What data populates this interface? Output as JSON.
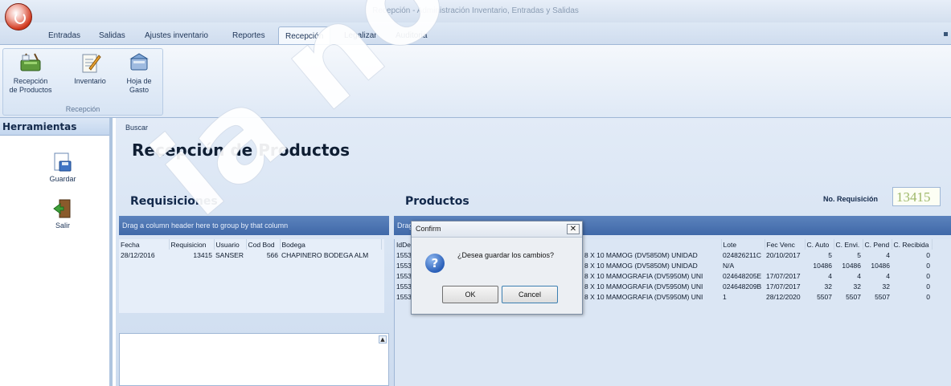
{
  "window": {
    "title": "Recepción - Administración Inventario, Entradas y Salidas"
  },
  "tabs": [
    {
      "label": "Entradas",
      "active": false
    },
    {
      "label": "Salidas",
      "active": false
    },
    {
      "label": "Ajustes inventario",
      "active": false
    },
    {
      "label": "Reportes",
      "active": false
    },
    {
      "label": "Recepción",
      "active": true
    },
    {
      "label": "Legalizar",
      "active": false
    },
    {
      "label": "Auditoria",
      "active": false
    }
  ],
  "ribbon": {
    "group_label": "Recepción",
    "buttons": [
      {
        "label_line1": "Recepción",
        "label_line2": "de Productos",
        "icon": "basket-icon"
      },
      {
        "label_line1": "Inventario",
        "label_line2": "",
        "icon": "clipboard-pencil-icon"
      },
      {
        "label_line1": "Hoja de",
        "label_line2": "Gasto",
        "icon": "basket-sheet-icon"
      }
    ]
  },
  "tools": {
    "header": "Herramientas",
    "items": [
      {
        "label": "Guardar",
        "icon": "save-icon"
      },
      {
        "label": "Salir",
        "icon": "exit-door-icon"
      }
    ]
  },
  "main": {
    "search_label": "Buscar",
    "page_title": "Recepción de Productos",
    "requisiciones": {
      "title": "Requisiciones",
      "group_hint": "Drag a column header here to group by that column",
      "columns": [
        "Fecha",
        "Requisicion",
        "Usuario",
        "Cod Bod",
        "Bodega"
      ],
      "rows": [
        [
          "28/12/2016",
          "13415",
          "SANSER",
          "566",
          "CHAPINERO BODEGA ALM"
        ]
      ]
    },
    "productos": {
      "title": "Productos",
      "req_label": "No. Requisición",
      "req_value": "13415",
      "group_hint": "Drag a column header here to group by that column",
      "columns": [
        "IdDe",
        "",
        "Lote",
        "Fec Venc",
        "C. Auto",
        "C. Envi.",
        "C. Pend",
        "C. Recibida"
      ],
      "rows": [
        [
          "1553",
          "8 X 10 MAMOG (DV5850M) UNIDAD",
          "024826211C",
          "20/10/2017",
          "5",
          "5",
          "4",
          "0"
        ],
        [
          "1553",
          "8 X 10 MAMOG (DV5850M) UNIDAD",
          "N/A",
          "",
          "10486",
          "10486",
          "10486",
          "0"
        ],
        [
          "1553",
          "8 X 10 MAMOGRAFIA (DV5950M) UNI",
          "024648205E",
          "17/07/2017",
          "4",
          "4",
          "4",
          "0"
        ],
        [
          "1553",
          "8 X 10 MAMOGRAFIA (DV5950M) UNI",
          "024648209B",
          "17/07/2017",
          "32",
          "32",
          "32",
          "0"
        ],
        [
          "1553",
          "8 X 10 MAMOGRAFIA (DV5950M) UNI",
          "1",
          "28/12/2020",
          "5507",
          "5507",
          "5507",
          "0"
        ]
      ]
    }
  },
  "dialog": {
    "title": "Confirm",
    "message": "¿Desea guardar los cambios?",
    "ok_label": "OK",
    "cancel_label": "Cancel",
    "close_glyph": "✕"
  },
  "watermark": {
    "text": "ia no cont"
  }
}
